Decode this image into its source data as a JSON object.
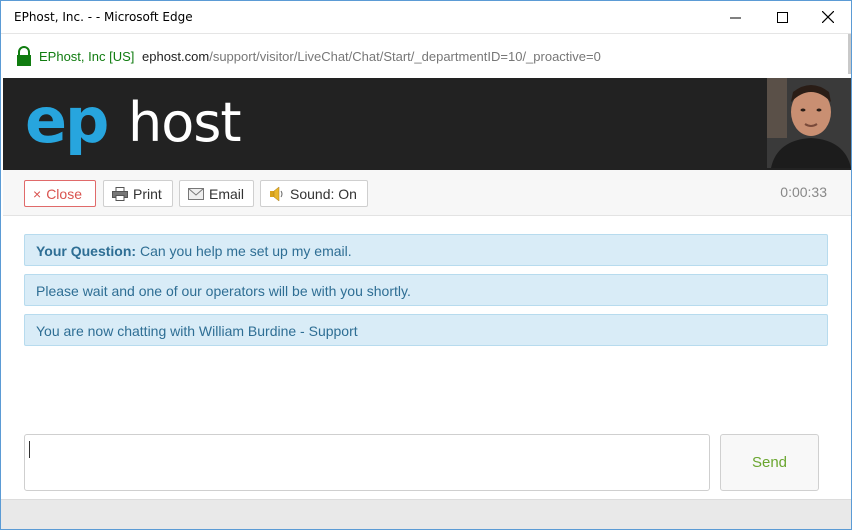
{
  "window": {
    "title": "EPhost, Inc. - - Microsoft Edge"
  },
  "address_bar": {
    "site_identity": "EPhost, Inc [US]",
    "url_host": "ephost.com",
    "url_path": "/support/visitor/LiveChat/Chat/Start/_departmentID=10/_proactive=0"
  },
  "header": {
    "logo_ep": "ep",
    "logo_host": "host"
  },
  "toolbar": {
    "close_icon": "×",
    "close_label": "Close",
    "print_label": "Print",
    "email_label": "Email",
    "sound_label": "Sound: On",
    "timer": "0:00:33"
  },
  "messages": [
    {
      "prefix": "Your Question:",
      "text": " Can you help me set up my email."
    },
    {
      "text": "Please wait and one of our operators will be with you shortly."
    },
    {
      "text": "You are now chatting with William Burdine - Support"
    }
  ],
  "composer": {
    "value": "",
    "send_label": "Send"
  },
  "colors": {
    "accent_blue": "#27a5de",
    "header_bg": "#222222",
    "message_bg": "#d9ecf7",
    "send_green": "#6aa62f",
    "close_red": "#d9534f"
  }
}
